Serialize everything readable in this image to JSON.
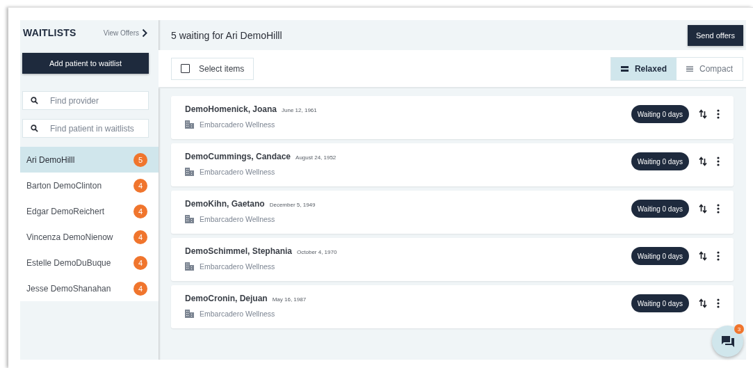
{
  "sidebar": {
    "title": "WAITLISTS",
    "view_offers": "View Offers",
    "add_button": "Add patient to waitlist",
    "search_fields": [
      {
        "placeholder": "Find provider"
      },
      {
        "placeholder": "Find patient in waitlists"
      }
    ],
    "providers": [
      {
        "name": "Ari DemoHilll",
        "count": "5",
        "selected": true
      },
      {
        "name": "Barton DemoClinton",
        "count": "4",
        "selected": false
      },
      {
        "name": "Edgar DemoReichert",
        "count": "4",
        "selected": false
      },
      {
        "name": "Vincenza DemoNienow",
        "count": "4",
        "selected": false
      },
      {
        "name": "Estelle DemoDuBuque",
        "count": "4",
        "selected": false
      },
      {
        "name": "Jesse DemoShanahan",
        "count": "4",
        "selected": false
      }
    ]
  },
  "header": {
    "title": "5 waiting for Ari DemoHilll",
    "send_button": "Send offers"
  },
  "toolbar": {
    "select_items": {
      "label": "Select items",
      "checked": false
    },
    "density": [
      {
        "label": "Relaxed",
        "selected": true
      },
      {
        "label": "Compact",
        "selected": false
      }
    ]
  },
  "patients": [
    {
      "name": "DemoHomenick, Joana",
      "dob": "June 12, 1961",
      "location": "Embarcadero Wellness",
      "status": "Waiting 0 days"
    },
    {
      "name": "DemoCummings, Candace",
      "dob": "August 24, 1952",
      "location": "Embarcadero Wellness",
      "status": "Waiting 0 days"
    },
    {
      "name": "DemoKihn, Gaetano",
      "dob": "December 5, 1949",
      "location": "Embarcadero Wellness",
      "status": "Waiting 0 days"
    },
    {
      "name": "DemoSchimmel, Stephania",
      "dob": "October 4, 1970",
      "location": "Embarcadero Wellness",
      "status": "Waiting 0 days"
    },
    {
      "name": "DemoCronin, Dejuan",
      "dob": "May 16, 1987",
      "location": "Embarcadero Wellness",
      "status": "Waiting 0 days"
    }
  ],
  "chat": {
    "badge": "3"
  }
}
